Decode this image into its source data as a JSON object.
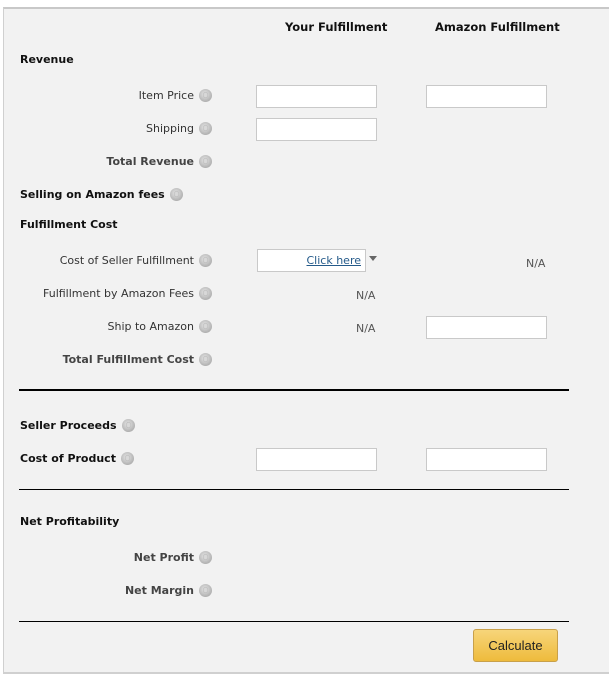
{
  "columns": {
    "your_fulfillment": "Your Fulfillment",
    "amazon_fulfillment": "Amazon Fulfillment"
  },
  "sections": {
    "revenue": "Revenue",
    "selling_fees": "Selling on Amazon fees",
    "fulfillment_cost": "Fulfillment Cost",
    "seller_proceeds": "Seller Proceeds",
    "cost_of_product": "Cost of Product",
    "net_profitability": "Net Profitability"
  },
  "rows": {
    "item_price": "Item Price",
    "shipping": "Shipping",
    "total_revenue": "Total Revenue",
    "cost_of_seller_fulfillment": "Cost of Seller Fulfillment",
    "fba_fees": "Fulfillment by Amazon Fees",
    "ship_to_amazon": "Ship to Amazon",
    "total_fulfillment_cost": "Total Fulfillment Cost",
    "net_profit": "Net Profit",
    "net_margin": "Net Margin"
  },
  "values": {
    "item_price_yours": "",
    "item_price_amazon": "",
    "shipping_yours": "",
    "seller_fulfillment_link": "Click here",
    "seller_fulfillment_amazon": "N/A",
    "fba_fees_yours": "N/A",
    "ship_to_amazon_yours": "N/A",
    "ship_to_amazon_amazon": "",
    "cost_of_product_yours": "",
    "cost_of_product_amazon": ""
  },
  "actions": {
    "calculate": "Calculate"
  },
  "icons": {
    "help": "help-icon",
    "dropdown": "caret-down-icon"
  }
}
